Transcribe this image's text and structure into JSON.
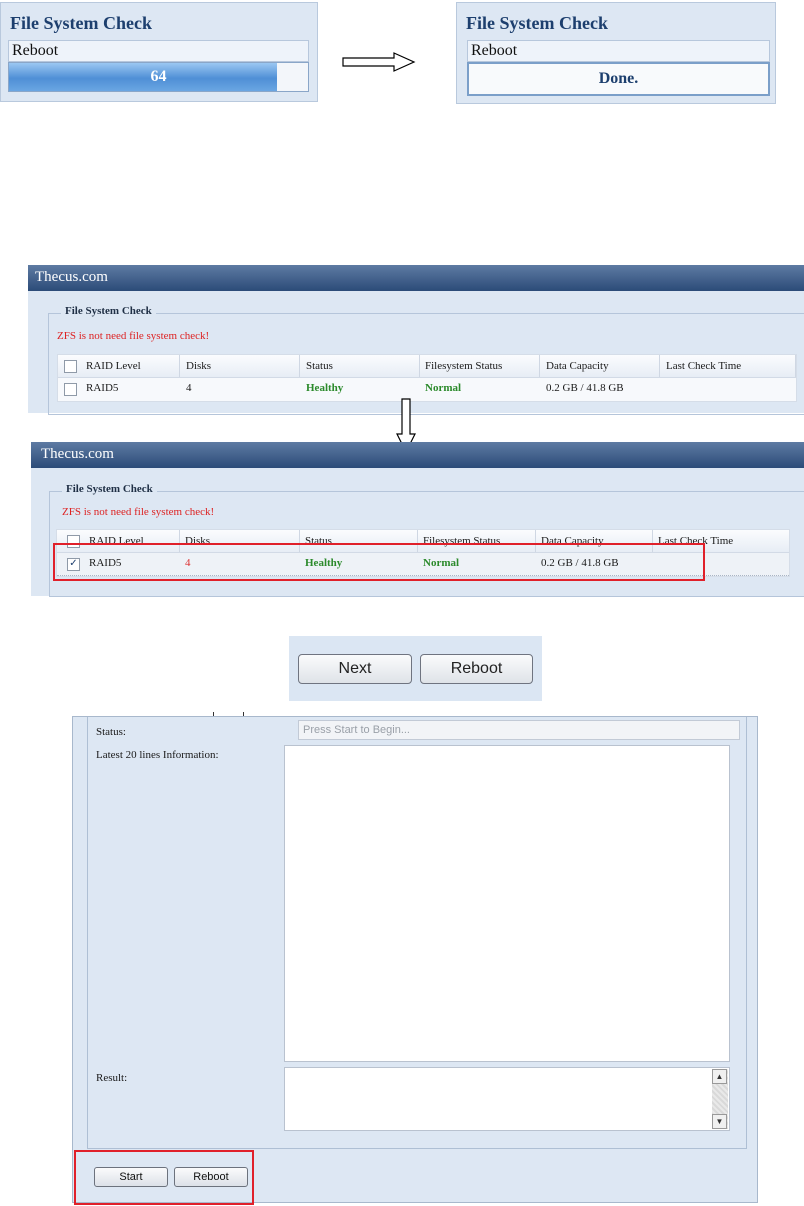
{
  "progress_before": {
    "title": "File System Check",
    "label": "Reboot",
    "progress_text": "64",
    "progress_fraction": 0.64
  },
  "progress_after": {
    "title": "File System Check",
    "label": "Reboot",
    "progress_text": "Done."
  },
  "window1": {
    "app_title": "Thecus.com",
    "section_title": "File System Check",
    "warning": "ZFS is not need file system check!",
    "columns": [
      "RAID Level",
      "Disks",
      "Status",
      "Filesystem Status",
      "Data Capacity",
      "Last Check Time"
    ],
    "row": {
      "checked": false,
      "raid_level": "RAID5",
      "disks": "4",
      "status": "Healthy",
      "fs_status": "Normal",
      "capacity": "0.2 GB / 41.8 GB",
      "last_check": ""
    }
  },
  "window2": {
    "app_title": "Thecus.com",
    "section_title": "File System Check",
    "warning": "ZFS is not need file system check!",
    "columns": [
      "RAID Level",
      "Disks",
      "Status",
      "Filesystem Status",
      "Data Capacity",
      "Last Check Time"
    ],
    "row": {
      "checked": true,
      "raid_level": "RAID5",
      "disks": "4",
      "status": "Healthy",
      "fs_status": "Normal",
      "capacity": "0.2 GB / 41.8 GB",
      "last_check": ""
    }
  },
  "buttons": {
    "next": "Next",
    "reboot": "Reboot"
  },
  "check_form": {
    "status_label": "Status:",
    "status_placeholder": "Press Start to Begin...",
    "info_label": "Latest 20 lines Information:",
    "result_label": "Result:",
    "start_button": "Start",
    "reboot_button": "Reboot"
  },
  "colors": {
    "title_bar": "#2b4b78",
    "panel_bg": "#dde7f3",
    "healthy_green": "#2b8a2b",
    "warning_red": "#dd2222",
    "highlight_red": "#e0202a"
  }
}
